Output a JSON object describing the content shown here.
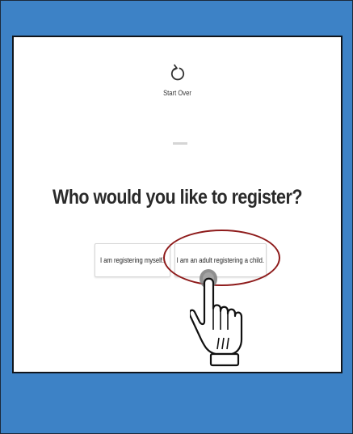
{
  "start_over": {
    "icon": "refresh-icon",
    "label": "Start Over"
  },
  "heading": "Who would you like to register?",
  "options": [
    {
      "label": "I am registering myself."
    },
    {
      "label": "I am an adult registering a child."
    }
  ],
  "annotation": {
    "highlight_color": "#8e1b1b",
    "pointer_icon": "hand-pointer-icon"
  },
  "colors": {
    "frame_background": "#3d82c6",
    "screen_background": "#ffffff",
    "heading_text": "#2a2a2a"
  }
}
